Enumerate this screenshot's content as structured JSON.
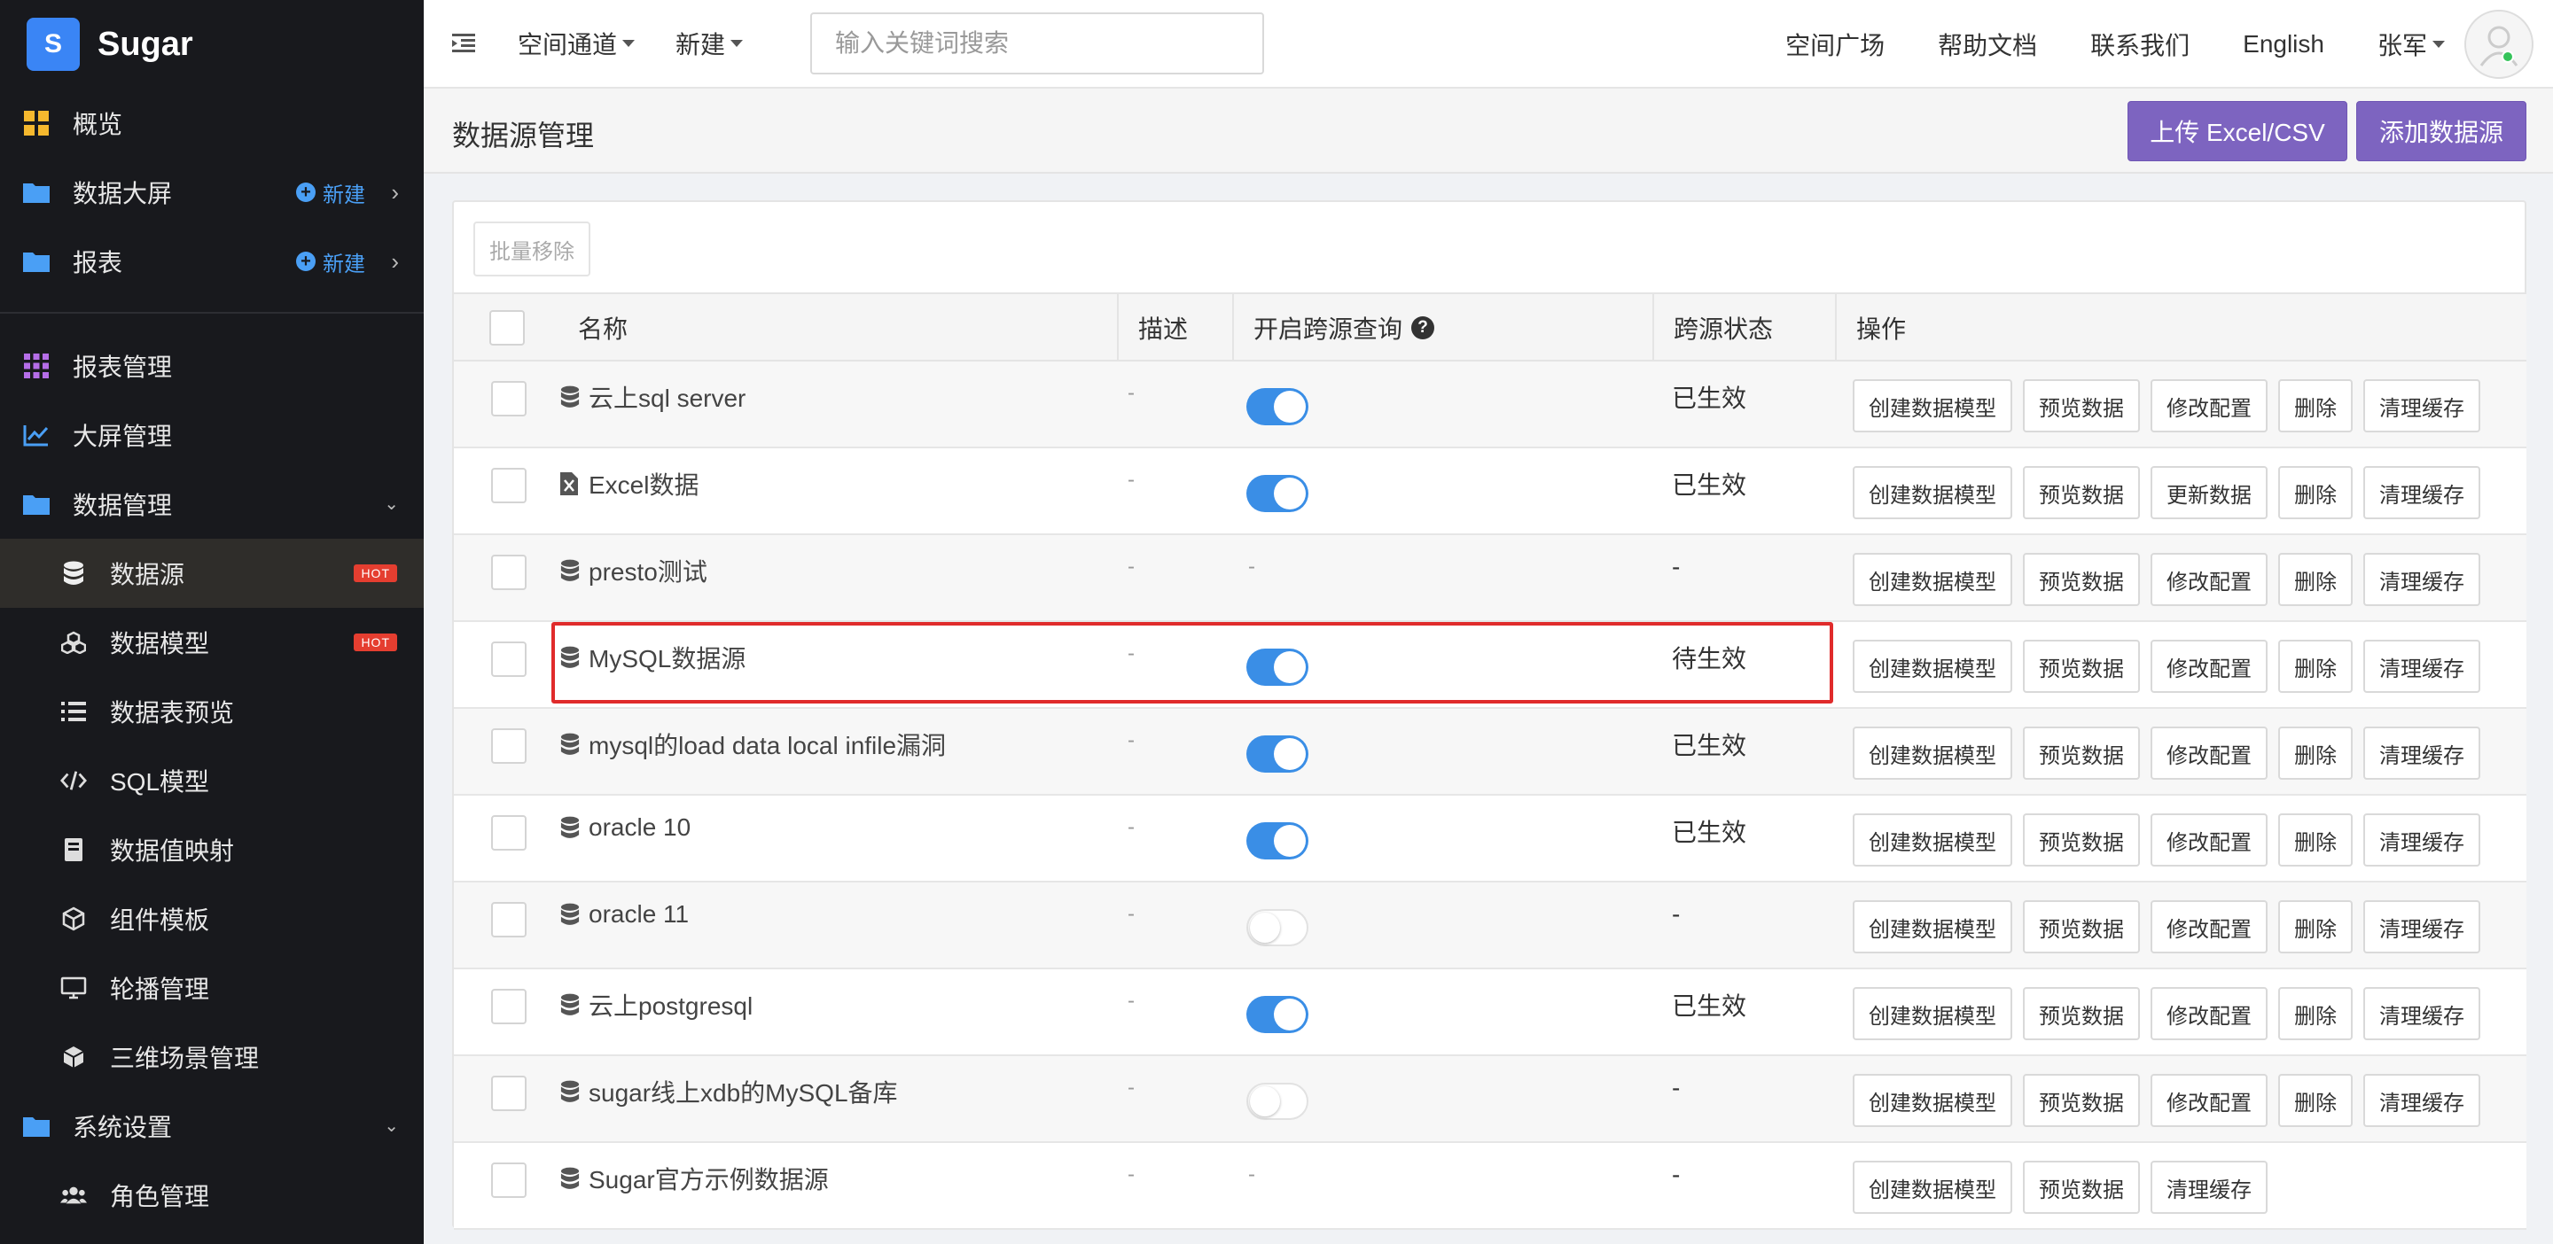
{
  "brand": {
    "logo_letter": "S",
    "name": "Sugar",
    "accent": "#3a85f5"
  },
  "sidebar": {
    "top_items": [
      {
        "label": "概览",
        "icon": "dashboard-grid-icon"
      },
      {
        "label": "数据大屏",
        "icon": "folder-icon",
        "new": "新建"
      },
      {
        "label": "报表",
        "icon": "folder-icon",
        "new": "新建"
      }
    ],
    "items": [
      {
        "label": "报表管理",
        "icon": "grid-apps-icon"
      },
      {
        "label": "大屏管理",
        "icon": "line-chart-icon"
      },
      {
        "label": "数据管理",
        "icon": "folder-icon",
        "expanded": true
      },
      {
        "label": "数据源",
        "icon": "database-icon",
        "badge": "HOT",
        "active": true
      },
      {
        "label": "数据模型",
        "icon": "cubes-icon",
        "badge": "HOT"
      },
      {
        "label": "数据表预览",
        "icon": "list-icon"
      },
      {
        "label": "SQL模型",
        "icon": "code-icon"
      },
      {
        "label": "数据值映射",
        "icon": "book-icon"
      },
      {
        "label": "组件模板",
        "icon": "cube-outline-icon"
      },
      {
        "label": "轮播管理",
        "icon": "monitor-icon"
      },
      {
        "label": "三维场景管理",
        "icon": "cube-icon"
      },
      {
        "label": "系统设置",
        "icon": "folder-icon",
        "expanded": true
      },
      {
        "label": "角色管理",
        "icon": "users-icon"
      }
    ]
  },
  "topbar": {
    "nav_space": "空间通道",
    "nav_new": "新建",
    "search_placeholder": "输入关键词搜索",
    "links": [
      "空间广场",
      "帮助文档",
      "联系我们",
      "English"
    ],
    "user": "张军"
  },
  "page": {
    "title": "数据源管理",
    "upload_btn": "上传 Excel/CSV",
    "add_btn": "添加数据源",
    "batch_remove": "批量移除"
  },
  "table": {
    "headers": [
      "名称",
      "描述",
      "开启跨源查询",
      "跨源状态",
      "操作"
    ],
    "rows": [
      {
        "name": "云上sql server",
        "icon": "database-icon",
        "desc": "-",
        "cross": "on",
        "status": "已生效",
        "ops": [
          "创建数据模型",
          "预览数据",
          "修改配置",
          "删除",
          "清理缓存"
        ]
      },
      {
        "name": "Excel数据",
        "icon": "excel-file-icon",
        "desc": "-",
        "cross": "on",
        "status": "已生效",
        "ops": [
          "创建数据模型",
          "预览数据",
          "更新数据",
          "删除",
          "清理缓存"
        ]
      },
      {
        "name": "presto测试",
        "icon": "database-icon",
        "desc": "-",
        "cross": "-",
        "status": "-",
        "ops": [
          "创建数据模型",
          "预览数据",
          "修改配置",
          "删除",
          "清理缓存"
        ]
      },
      {
        "name": "MySQL数据源",
        "icon": "database-icon",
        "desc": "-",
        "cross": "on",
        "status": "待生效",
        "ops": [
          "创建数据模型",
          "预览数据",
          "修改配置",
          "删除",
          "清理缓存"
        ]
      },
      {
        "name": "mysql的load data local infile漏洞",
        "icon": "database-icon",
        "desc": "-",
        "cross": "on",
        "status": "已生效",
        "ops": [
          "创建数据模型",
          "预览数据",
          "修改配置",
          "删除",
          "清理缓存"
        ]
      },
      {
        "name": "oracle 10",
        "icon": "database-icon",
        "desc": "-",
        "cross": "on",
        "status": "已生效",
        "ops": [
          "创建数据模型",
          "预览数据",
          "修改配置",
          "删除",
          "清理缓存"
        ]
      },
      {
        "name": "oracle 11",
        "icon": "database-icon",
        "desc": "-",
        "cross": "off",
        "status": "-",
        "ops": [
          "创建数据模型",
          "预览数据",
          "修改配置",
          "删除",
          "清理缓存"
        ]
      },
      {
        "name": "云上postgresql",
        "icon": "database-icon",
        "desc": "-",
        "cross": "on",
        "status": "已生效",
        "ops": [
          "创建数据模型",
          "预览数据",
          "修改配置",
          "删除",
          "清理缓存"
        ]
      },
      {
        "name": "sugar线上xdb的MySQL备库",
        "icon": "database-icon",
        "desc": "-",
        "cross": "off",
        "status": "-",
        "ops": [
          "创建数据模型",
          "预览数据",
          "修改配置",
          "删除",
          "清理缓存"
        ]
      },
      {
        "name": "Sugar官方示例数据源",
        "icon": "database-icon",
        "desc": "-",
        "cross": "-",
        "status": "-",
        "ops": [
          "创建数据模型",
          "预览数据",
          "清理缓存"
        ]
      }
    ]
  },
  "colors": {
    "primary_button": "#7d64c0",
    "toggle_on": "#3a8ee6",
    "highlight": "#e02b2b",
    "sidebar_bg": "#18191d"
  }
}
